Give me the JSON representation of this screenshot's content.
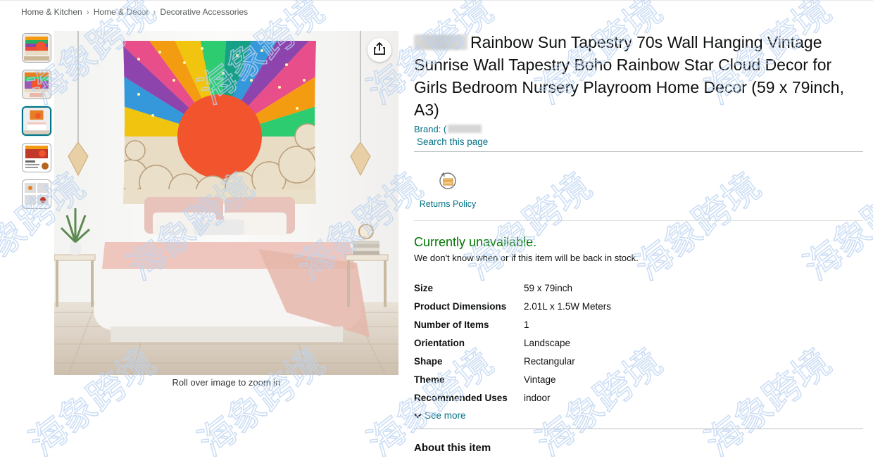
{
  "breadcrumb": {
    "items": [
      "Home & Kitchen",
      "Home & Décor",
      "Decorative Accessories"
    ],
    "separator": "›"
  },
  "gallery": {
    "thumbnail_count": 5,
    "selected_index": 2,
    "zoom_caption": "Roll over image to zoom in"
  },
  "product": {
    "title": "Rainbow Sun Tapestry 70s Wall Hanging Vintage Sunrise Wall Tapestry Boho Rainbow Star Cloud Decor for Girls Bedroom Nursery Playroom Home Decor (59 x 79inch, A3)",
    "brand_label": "Brand: (",
    "search_link": "Search this page",
    "returns_label": "Returns Policy",
    "availability": "Currently unavailable.",
    "stock_note": "We don't know when or if this item will be back in stock."
  },
  "specs": [
    {
      "key": "Size",
      "value": "59 x 79inch"
    },
    {
      "key": "Product Dimensions",
      "value": "2.01L x 1.5W Meters"
    },
    {
      "key": "Number of Items",
      "value": "1"
    },
    {
      "key": "Orientation",
      "value": "Landscape"
    },
    {
      "key": "Shape",
      "value": "Rectangular"
    },
    {
      "key": "Theme",
      "value": "Vintage"
    },
    {
      "key": "Recommended Uses",
      "value": "indoor"
    }
  ],
  "see_more": "See more",
  "about_heading": "About this item",
  "watermark_text": "海象跨境",
  "colors": {
    "link": "#007185",
    "in_stock_green": "#007600",
    "text": "#0f1111",
    "selected_thumb_border": "#007185",
    "watermark": "#bcd3f0"
  },
  "icons": {
    "share": "share-icon",
    "returns": "returns-box-icon",
    "chevron": "chevron-down-icon"
  }
}
